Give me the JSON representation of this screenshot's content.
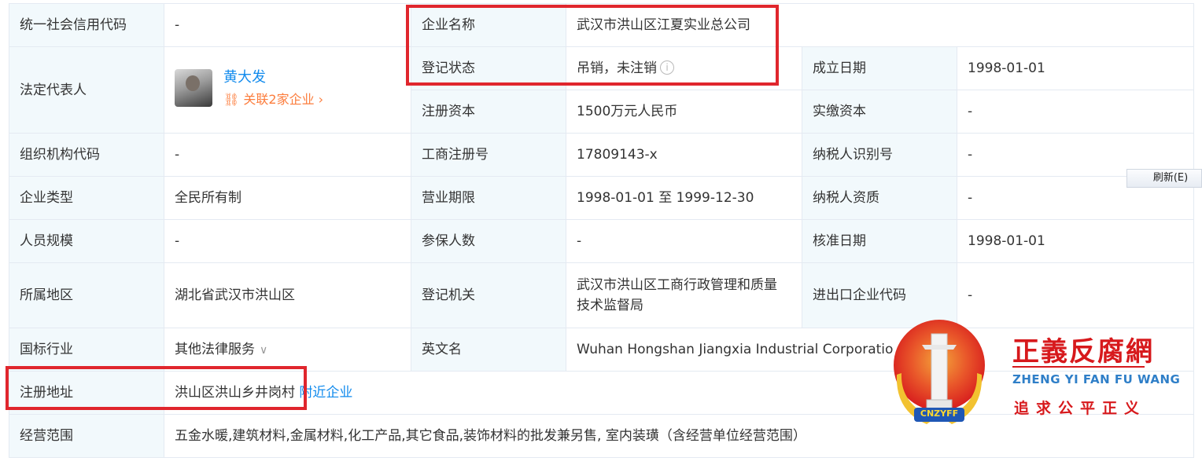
{
  "labels": {
    "credit_code": "统一社会信用代码",
    "company_name": "企业名称",
    "legal_rep": "法定代表人",
    "reg_status": "登记状态",
    "found_date": "成立日期",
    "reg_capital": "注册资本",
    "paid_capital": "实缴资本",
    "org_code": "组织机构代码",
    "biz_reg_no": "工商注册号",
    "taxpayer_id": "纳税人识别号",
    "company_type": "企业类型",
    "biz_term": "营业期限",
    "taxpayer_qual": "纳税人资质",
    "staff_size": "人员规模",
    "insured_count": "参保人数",
    "approve_date": "核准日期",
    "region": "所属地区",
    "reg_authority": "登记机关",
    "import_export_code": "进出口企业代码",
    "industry": "国标行业",
    "english_name": "英文名",
    "reg_address": "注册地址",
    "biz_scope": "经营范围"
  },
  "values": {
    "credit_code": "-",
    "company_name": "武汉市洪山区江夏实业总公司",
    "legal_rep_name": "黄大发",
    "legal_rep_related": "关联2家企业",
    "reg_status": "吊销，未注销",
    "found_date": "1998-01-01",
    "reg_capital": "1500万元人民币",
    "paid_capital": "-",
    "org_code": "-",
    "biz_reg_no": "17809143-x",
    "taxpayer_id": "-",
    "company_type": "全民所有制",
    "biz_term": "1998-01-01 至 1999-12-30",
    "taxpayer_qual": "-",
    "staff_size": "-",
    "insured_count": "-",
    "approve_date": "1998-01-01",
    "region": "湖北省武汉市洪山区",
    "reg_authority_line1": "武汉市洪山区工商行政管理和质量",
    "reg_authority_line2": "技术监督局",
    "import_export_code": "-",
    "industry": "其他法律服务",
    "english_name": "Wuhan Hongshan Jiangxia Industrial Corporatio",
    "reg_address": "洪山区洪山乡井岗村",
    "nearby_link": "附近企业",
    "biz_scope": "五金水暖,建筑材料,金属材料,化工产品,其它食品,装饰材料的批发兼另售, 室内装璜（含经营单位经营范围）"
  },
  "refresh_button": "刷新(E)",
  "watermark": {
    "title": "正義反腐網",
    "pinyin": "ZHENG YI FAN FU WANG",
    "slogan": "追求公平正义",
    "badge_text": "CNZYFF"
  },
  "colors": {
    "label_bg": "#f2f9fc",
    "border": "#e4eaf2",
    "link": "#128bed",
    "related_orange": "#fc7d3d",
    "highlight_red": "#e0262d"
  }
}
